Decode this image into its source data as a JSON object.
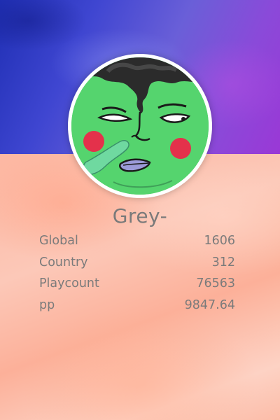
{
  "profile": {
    "username": "Grey-"
  },
  "stats": [
    {
      "label": "Global",
      "value": "1606"
    },
    {
      "label": "Country",
      "value": "312"
    },
    {
      "label": "Playcount",
      "value": "76563"
    },
    {
      "label": "pp",
      "value": "9847.64"
    }
  ],
  "colors": {
    "banner_start": "#1f2fb4",
    "banner_end": "#9a38d6",
    "body_bg": "#fcc8b8",
    "text": "#7a7a7a",
    "avatar_skin": "#4fd26c",
    "avatar_ring": "#ffffff"
  }
}
